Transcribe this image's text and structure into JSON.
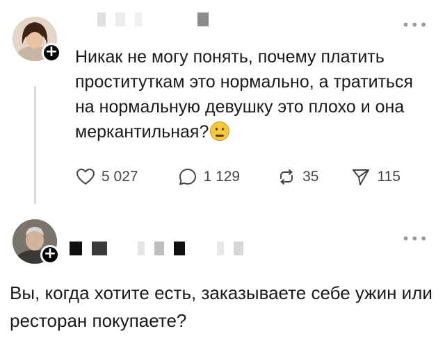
{
  "posts": [
    {
      "text": "Никак не могу понять, почему платить проституткам это нормально, а тратиться на нормальную девушку это плохо и она меркантильная?",
      "emoji": "thinking-face",
      "actions": {
        "likes": "5 027",
        "replies": "1 129",
        "reposts": "35",
        "shares": "115"
      }
    },
    {
      "text": "Вы, когда хотите есть, заказываете себе ужин или ресторан покупаете?"
    }
  ],
  "icons": {
    "more": "more-options-icon",
    "like": "heart-icon",
    "reply": "comment-icon",
    "repost": "repost-icon",
    "share": "send-icon",
    "follow": "plus-icon"
  },
  "colors": {
    "text": "#1a1a1a",
    "muted": "#444444",
    "badge": "#000000",
    "thread_line": "#d9d9d9"
  }
}
